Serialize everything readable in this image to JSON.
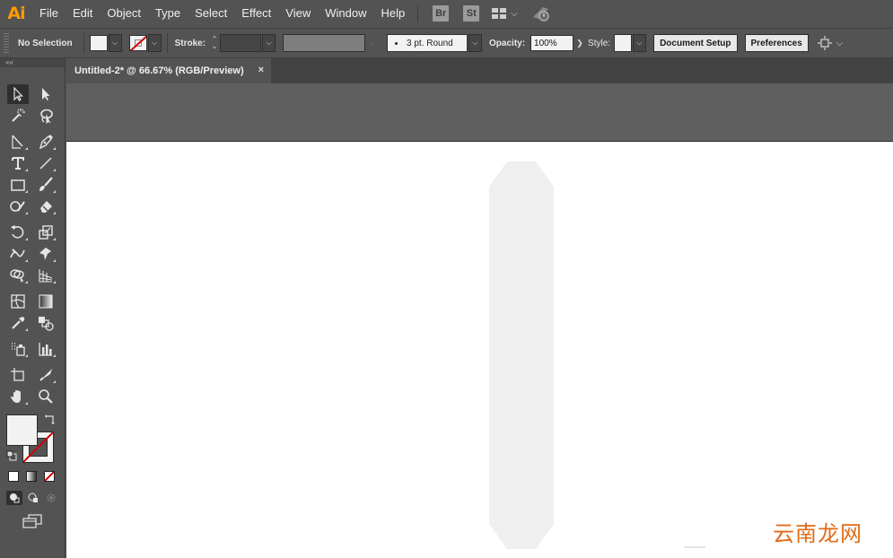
{
  "app": {
    "logo_text": "Ai",
    "menu": [
      "File",
      "Edit",
      "Object",
      "Type",
      "Select",
      "Effect",
      "View",
      "Window",
      "Help"
    ],
    "bridge_label": "Br",
    "stock_label": "St"
  },
  "control_bar": {
    "selection_label": "No Selection",
    "stroke_label": "Stroke:",
    "brush_value": "3 pt. Round",
    "opacity_label": "Opacity:",
    "opacity_value": "100%",
    "style_label": "Style:",
    "document_setup_label": "Document Setup",
    "preferences_label": "Preferences"
  },
  "document": {
    "tab_title": "Untitled-2* @ 66.67% (RGB/Preview)",
    "close_glyph": "×"
  },
  "toolbox": {
    "collapse_glyph": "««"
  },
  "watermark": {
    "text": "云南龙网"
  },
  "colors": {
    "ui_bg": "#535353",
    "fill": "#f2f2f2",
    "shape_fill": "#efefef",
    "none_red": "#d40000",
    "logo_orange": "#ff9a00",
    "watermark_orange": "#e16b17"
  }
}
